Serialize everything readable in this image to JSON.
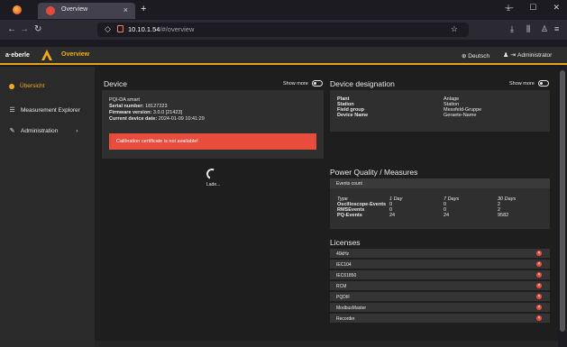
{
  "browser": {
    "tab_title": "Overview",
    "tab_close": "×",
    "new_tab": "+",
    "url_host": "10.10.1.54",
    "url_path": "/#/overview",
    "download_glyph": "⤓",
    "window_controls": [
      "—",
      "☐",
      "✕"
    ]
  },
  "header": {
    "logo_text": "a·eberle",
    "title": "Overview",
    "language": "⊕ Deutsch",
    "user_label": "Administrator"
  },
  "sidebar": {
    "items": [
      {
        "label": "Übersicht"
      },
      {
        "label": "Measurement Explorer"
      },
      {
        "label": "Administration",
        "chevron": "›"
      }
    ]
  },
  "device": {
    "title": "Device",
    "show_more": "Show more",
    "model": "PQI-DA smart",
    "serial_label": "Serial number:",
    "serial_value": "18127223",
    "firmware_label": "Firmware version:",
    "firmware_value": "3.0.0 [21423]",
    "date_label": "Current device date:",
    "date_value": "2024-01-09 10:41:29",
    "alert": "Calibration certificate is not available!"
  },
  "designation": {
    "title": "Device designation",
    "show_more": "Show more",
    "rows": [
      {
        "key": "Plant",
        "value": "Anlage"
      },
      {
        "key": "Station",
        "value": "Station"
      },
      {
        "key": "Field group",
        "value": "Messfeld-Gruppe"
      },
      {
        "key": "Device Name",
        "value": "Geraete-Name"
      }
    ]
  },
  "loading": {
    "text": "Lade..."
  },
  "pq": {
    "title": "Power Quality / Measures",
    "events_header": "Events count",
    "columns": [
      "Type",
      "1 Day",
      "7 Days",
      "30 Days"
    ],
    "rows": [
      {
        "type": "Oscilloscope-Events",
        "d1": "0",
        "d7": "0",
        "d30": "2"
      },
      {
        "type": "RMSEvents",
        "d1": "0",
        "d7": "0",
        "d30": "2"
      },
      {
        "type": "PQ-Events",
        "d1": "24",
        "d7": "24",
        "d30": "9582"
      }
    ]
  },
  "licenses": {
    "title": "Licenses",
    "items": [
      "40kHz",
      "IEC104",
      "IEC61850",
      "RCM",
      "PQDIF",
      "ModbusMaster",
      "Recorder"
    ]
  }
}
